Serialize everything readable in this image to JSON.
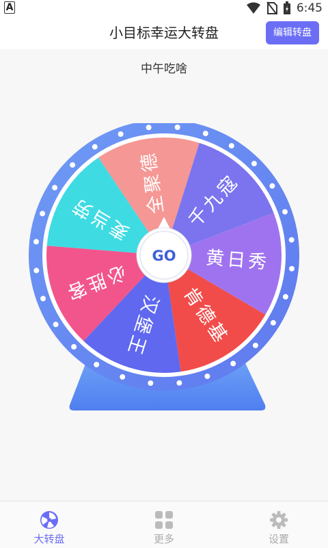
{
  "status_bar": {
    "time": "6:45",
    "left_icon": "A"
  },
  "header": {
    "title": "小目标幸运大转盘",
    "edit_button": "编辑转盘"
  },
  "wheel": {
    "title": "中午吃啥",
    "center_label": "GO",
    "segments": [
      {
        "label": "全聚德",
        "color": "#f59794"
      },
      {
        "label": "千九寇",
        "color": "#7b74ee"
      },
      {
        "label": "黄日秀",
        "color": "#9f73ef"
      },
      {
        "label": "肯德基",
        "color": "#f14c4a"
      },
      {
        "label": "汉堡王",
        "color": "#5f68ef"
      },
      {
        "label": "必胜客",
        "color": "#f2558b"
      },
      {
        "label": "麦当劳",
        "color": "#3fdbe3"
      }
    ],
    "rim_color": "#6b8ef4",
    "stand_color": "#5a88f0"
  },
  "bottom_nav": {
    "items": [
      {
        "label": "大转盘",
        "icon": "wheel-icon",
        "active": true
      },
      {
        "label": "更多",
        "icon": "grid-icon",
        "active": false
      },
      {
        "label": "设置",
        "icon": "gear-icon",
        "active": false
      }
    ],
    "active_color": "#6b6ef5",
    "inactive_color": "#bbbbbb"
  }
}
